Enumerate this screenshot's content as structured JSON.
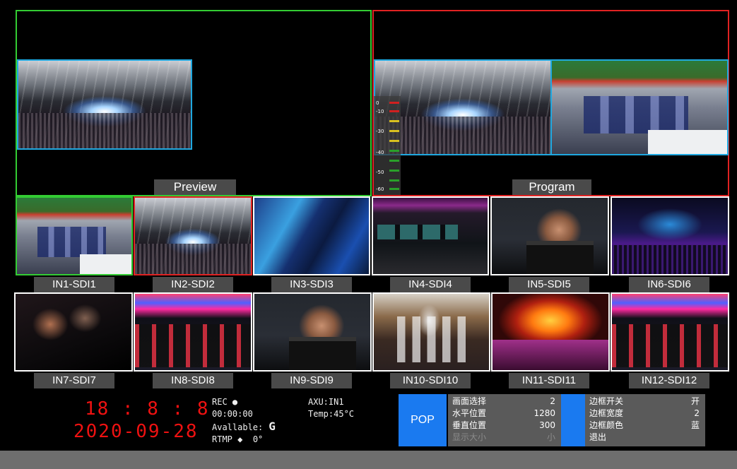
{
  "preview": {
    "label": "Preview"
  },
  "program": {
    "label": "Program"
  },
  "meter": {
    "ticks": [
      "0",
      "-10",
      "-30",
      "-40",
      "-50",
      "-60"
    ]
  },
  "inputs": [
    {
      "label": "IN1-SDI1"
    },
    {
      "label": "IN2-SDI2"
    },
    {
      "label": "IN3-SDI3"
    },
    {
      "label": "IN4-SDI4"
    },
    {
      "label": "IN5-SDI5"
    },
    {
      "label": "IN6-SDI6"
    },
    {
      "label": "IN7-SDI7"
    },
    {
      "label": "IN8-SDI8"
    },
    {
      "label": "IN9-SDI9"
    },
    {
      "label": "IN10-SDI10"
    },
    {
      "label": "IN11-SDI11"
    },
    {
      "label": "IN12-SDI12"
    }
  ],
  "status": {
    "time": "18 : 8 : 8",
    "date": "2020-09-28",
    "rec_label": "REC",
    "rec_time": "00:00:00",
    "available_label": "Avallable:",
    "available_value": "G",
    "rtmp_label": "RTMP",
    "rtmp_value": "0°",
    "axu": "AXU:IN1",
    "temp": "Temp:45°C"
  },
  "pop_menu": {
    "button_label": "POP",
    "left_rows": [
      {
        "key": "画面选择",
        "value": "2"
      },
      {
        "key": "水平位置",
        "value": "1280"
      },
      {
        "key": "垂直位置",
        "value": "300"
      },
      {
        "key": "显示大小",
        "value": "小"
      }
    ],
    "right_rows": [
      {
        "key": "边框开关",
        "value": "开"
      },
      {
        "key": "边框宽度",
        "value": "2"
      },
      {
        "key": "边框颜色",
        "value": "蓝"
      },
      {
        "key": "退出",
        "value": ""
      }
    ]
  },
  "colors": {
    "preview_border": "#33cc33",
    "program_border": "#e02222",
    "pip_border": "#1fa8e0",
    "accent": "#1a7af0",
    "clock": "#ee1111"
  }
}
